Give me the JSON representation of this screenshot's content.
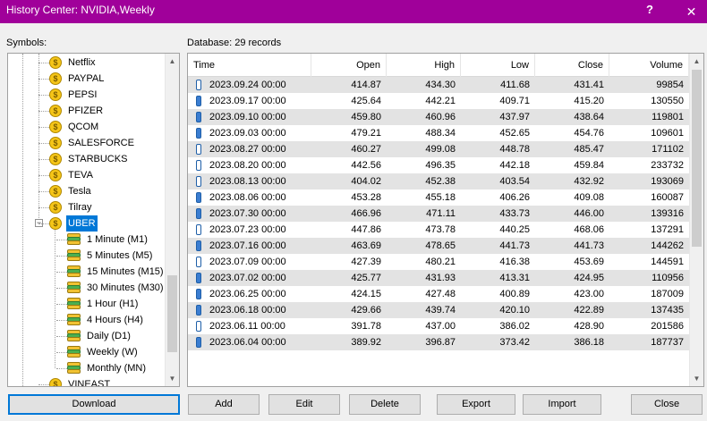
{
  "window": {
    "title": "History Center: NVIDIA,Weekly",
    "help": "?",
    "close": "✕"
  },
  "symbols_label": "Symbols:",
  "database_label": "Database: 29 records",
  "tree": {
    "symbols": [
      "Netflix",
      "PAYPAL",
      "PEPSI",
      "PFIZER",
      "QCOM",
      "SALESFORCE",
      "STARBUCKS",
      "TEVA",
      "Tesla",
      "Tilray"
    ],
    "expanded_symbol": "UBER",
    "timeframes": [
      "1 Minute (M1)",
      "5 Minutes (M5)",
      "15 Minutes (M15)",
      "30 Minutes (M30)",
      "1 Hour (H1)",
      "4 Hours (H4)",
      "Daily (D1)",
      "Weekly (W)",
      "Monthly (MN)"
    ],
    "next_symbol": "VINEAST"
  },
  "grid": {
    "columns": [
      "Time",
      "Open",
      "High",
      "Low",
      "Close",
      "Volume"
    ],
    "rows": [
      {
        "time": "2023.09.24 00:00",
        "open": "414.87",
        "high": "434.30",
        "low": "411.68",
        "close": "431.41",
        "volume": "99854",
        "dir": "bull"
      },
      {
        "time": "2023.09.17 00:00",
        "open": "425.64",
        "high": "442.21",
        "low": "409.71",
        "close": "415.20",
        "volume": "130550",
        "dir": "bear"
      },
      {
        "time": "2023.09.10 00:00",
        "open": "459.80",
        "high": "460.96",
        "low": "437.97",
        "close": "438.64",
        "volume": "119801",
        "dir": "bear"
      },
      {
        "time": "2023.09.03 00:00",
        "open": "479.21",
        "high": "488.34",
        "low": "452.65",
        "close": "454.76",
        "volume": "109601",
        "dir": "bear"
      },
      {
        "time": "2023.08.27 00:00",
        "open": "460.27",
        "high": "499.08",
        "low": "448.78",
        "close": "485.47",
        "volume": "171102",
        "dir": "bull"
      },
      {
        "time": "2023.08.20 00:00",
        "open": "442.56",
        "high": "496.35",
        "low": "442.18",
        "close": "459.84",
        "volume": "233732",
        "dir": "bull"
      },
      {
        "time": "2023.08.13 00:00",
        "open": "404.02",
        "high": "452.38",
        "low": "403.54",
        "close": "432.92",
        "volume": "193069",
        "dir": "bull"
      },
      {
        "time": "2023.08.06 00:00",
        "open": "453.28",
        "high": "455.18",
        "low": "406.26",
        "close": "409.08",
        "volume": "160087",
        "dir": "bear"
      },
      {
        "time": "2023.07.30 00:00",
        "open": "466.96",
        "high": "471.11",
        "low": "433.73",
        "close": "446.00",
        "volume": "139316",
        "dir": "bear"
      },
      {
        "time": "2023.07.23 00:00",
        "open": "447.86",
        "high": "473.78",
        "low": "440.25",
        "close": "468.06",
        "volume": "137291",
        "dir": "bull"
      },
      {
        "time": "2023.07.16 00:00",
        "open": "463.69",
        "high": "478.65",
        "low": "441.73",
        "close": "441.73",
        "volume": "144262",
        "dir": "bear"
      },
      {
        "time": "2023.07.09 00:00",
        "open": "427.39",
        "high": "480.21",
        "low": "416.38",
        "close": "453.69",
        "volume": "144591",
        "dir": "bull"
      },
      {
        "time": "2023.07.02 00:00",
        "open": "425.77",
        "high": "431.93",
        "low": "413.31",
        "close": "424.95",
        "volume": "110956",
        "dir": "bear"
      },
      {
        "time": "2023.06.25 00:00",
        "open": "424.15",
        "high": "427.48",
        "low": "400.89",
        "close": "423.00",
        "volume": "187009",
        "dir": "bear"
      },
      {
        "time": "2023.06.18 00:00",
        "open": "429.66",
        "high": "439.74",
        "low": "420.10",
        "close": "422.89",
        "volume": "137435",
        "dir": "bear"
      },
      {
        "time": "2023.06.11 00:00",
        "open": "391.78",
        "high": "437.00",
        "low": "386.02",
        "close": "428.90",
        "volume": "201586",
        "dir": "bull"
      },
      {
        "time": "2023.06.04 00:00",
        "open": "389.92",
        "high": "396.87",
        "low": "373.42",
        "close": "386.18",
        "volume": "187737",
        "dir": "bear"
      }
    ]
  },
  "buttons": {
    "download": "Download",
    "add": "Add",
    "edit": "Edit",
    "delete": "Delete",
    "export": "Export",
    "import": "Import",
    "close": "Close"
  }
}
